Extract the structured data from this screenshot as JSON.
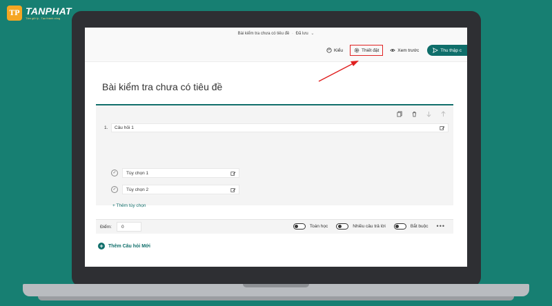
{
  "brand": {
    "logo_mark": "TP",
    "name": "TANPHAT",
    "tagline": "Tâm giữ lý - Tạo thành công"
  },
  "header": {
    "doc_title": "Bài kiểm tra chưa có tiêu đề",
    "save_status": "Đã lưu"
  },
  "toolbar": {
    "style_label": "Kiểu",
    "settings_label": "Thiết đặt",
    "preview_label": "Xem trước",
    "collect_label": "Thu thập c"
  },
  "form": {
    "title": "Bài kiểm tra chưa có tiêu đề",
    "question": {
      "number": "1.",
      "text": "Câu hỏi 1",
      "options": [
        "Tùy chọn 1",
        "Tùy chọn 2"
      ],
      "add_option": "+ Thêm tùy chọn",
      "score_label": "Điểm:",
      "score_value": "0",
      "toggles": [
        "Toán học",
        "Nhiều câu trả lời",
        "Bắt buộc"
      ],
      "more": "•••"
    },
    "add_question": "Thêm Câu hỏi Mới"
  },
  "colors": {
    "accent": "#0f6e6a",
    "background": "#177f72",
    "highlight": "#e02020"
  }
}
